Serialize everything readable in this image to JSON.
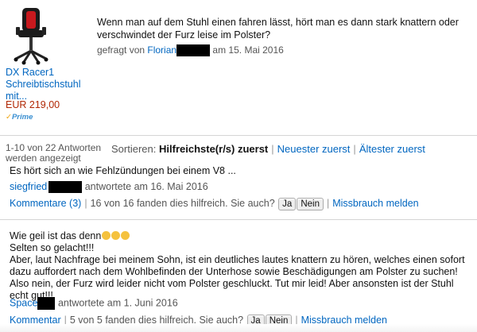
{
  "product": {
    "name": "DX Racer1 Schreibtischstuhl mit...",
    "price": "EUR 219,00",
    "prime_label": "Prime",
    "image_icon": "office-chair-image"
  },
  "question": {
    "text": "Wenn man auf dem Stuhl einen fahren lässt, hört man es dann stark knattern oder verschwindet der Furz leise im Polster?",
    "asked_prefix": "gefragt von",
    "asker": "Florian",
    "date": "am 15. Mai 2016"
  },
  "answers_header": {
    "count_text": "1-10 von 22 Antworten werden angezeigt",
    "sort_label": "Sortieren:",
    "sort_options": [
      "Hilfreichste(r/s) zuerst",
      "Neuester zuerst",
      "Ältester zuerst"
    ]
  },
  "answers": [
    {
      "lines": [
        "Es hört sich an wie Fehlzündungen bei einem V8 ..."
      ],
      "author": "siegfried",
      "answered": "antwortete am 16. Mai 2016",
      "comments": "Kommentare (3)",
      "helpful": "16 von 16 fanden dies hilfreich. Sie auch?",
      "yes": "Ja",
      "no": "Nein",
      "report": "Missbrauch melden"
    },
    {
      "lines": [
        "Wie geil ist das denn",
        "Selten so gelacht!!!",
        "Aber, laut Nachfrage bei meinem Sohn, ist ein deutliches lautes knattern zu hören, welches einen sofort dazu auffordert nach dem Wohlbefinden der Unterhose sowie Beschädigungen am Polster zu suchen!",
        "Also nein, der Furz wird leider nicht vom Polster geschluckt. Tut mir leid! Aber ansonsten ist der Stuhl echt gut!!!"
      ],
      "author": "Space",
      "answered": "antwortete am 1. Juni 2016",
      "comments": "Kommentar",
      "helpful": "5 von 5 fanden dies hilfreich. Sie auch?",
      "yes": "Ja",
      "no": "Nein",
      "report": "Missbrauch melden"
    }
  ],
  "colors": {
    "link": "#0066c0",
    "price": "#b12704",
    "redaction": "#000000"
  }
}
